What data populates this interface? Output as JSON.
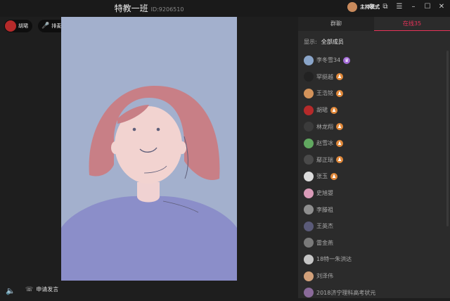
{
  "titlebar": {
    "title": "特教一班",
    "room_id": "ID:9206510",
    "mode_label": "主持模式"
  },
  "stage": {
    "teacher_name": "胡珺",
    "mic_label": "排麦",
    "apply_label": "申请发言"
  },
  "panel": {
    "tabs": [
      {
        "label": "群聊"
      },
      {
        "label": "在线35"
      }
    ],
    "filter_label": "显示:",
    "filter_value": "全部成员",
    "members": [
      {
        "name": "李冬雪34",
        "color": "#8aa5c9",
        "badge": "crown",
        "badge_color": "#a26ad6"
      },
      {
        "name": "罕挺越",
        "color": "#222222",
        "badge": "person",
        "badge_color": "#e0883a"
      },
      {
        "name": "王浩铭",
        "color": "#d2925a",
        "badge": "person",
        "badge_color": "#e0883a"
      },
      {
        "name": "胡珺",
        "color": "#b52a2a",
        "badge": "person",
        "badge_color": "#e0883a"
      },
      {
        "name": "林龙翔",
        "color": "#3b3b3b",
        "badge": "person",
        "badge_color": "#e0883a"
      },
      {
        "name": "赵雪冰",
        "color": "#61a860",
        "badge": "person",
        "badge_color": "#e0883a"
      },
      {
        "name": "鄢正瑞",
        "color": "#4a4a4a",
        "badge": "person",
        "badge_color": "#e0883a"
      },
      {
        "name": "张玉",
        "color": "#dcdcdc",
        "badge": "person",
        "badge_color": "#e0883a"
      },
      {
        "name": "史旭曌",
        "color": "#d99bb8",
        "badge": "",
        "badge_color": ""
      },
      {
        "name": "李滕祖",
        "color": "#8e8e8e",
        "badge": "",
        "badge_color": ""
      },
      {
        "name": "王英杰",
        "color": "#5a5a78",
        "badge": "",
        "badge_color": ""
      },
      {
        "name": "雷金燕",
        "color": "#7a7a7a",
        "badge": "",
        "badge_color": ""
      },
      {
        "name": "18特一朱洪达",
        "color": "#c6c6c6",
        "badge": "",
        "badge_color": ""
      },
      {
        "name": "刘泽伟",
        "color": "#d1a07a",
        "badge": "",
        "badge_color": ""
      },
      {
        "name": "2018济宁理科高考状元",
        "color": "#8a6a9a",
        "badge": "",
        "badge_color": ""
      }
    ]
  },
  "colors": {
    "accent": "#e8335a",
    "video_bg": "#a3b0cd"
  }
}
